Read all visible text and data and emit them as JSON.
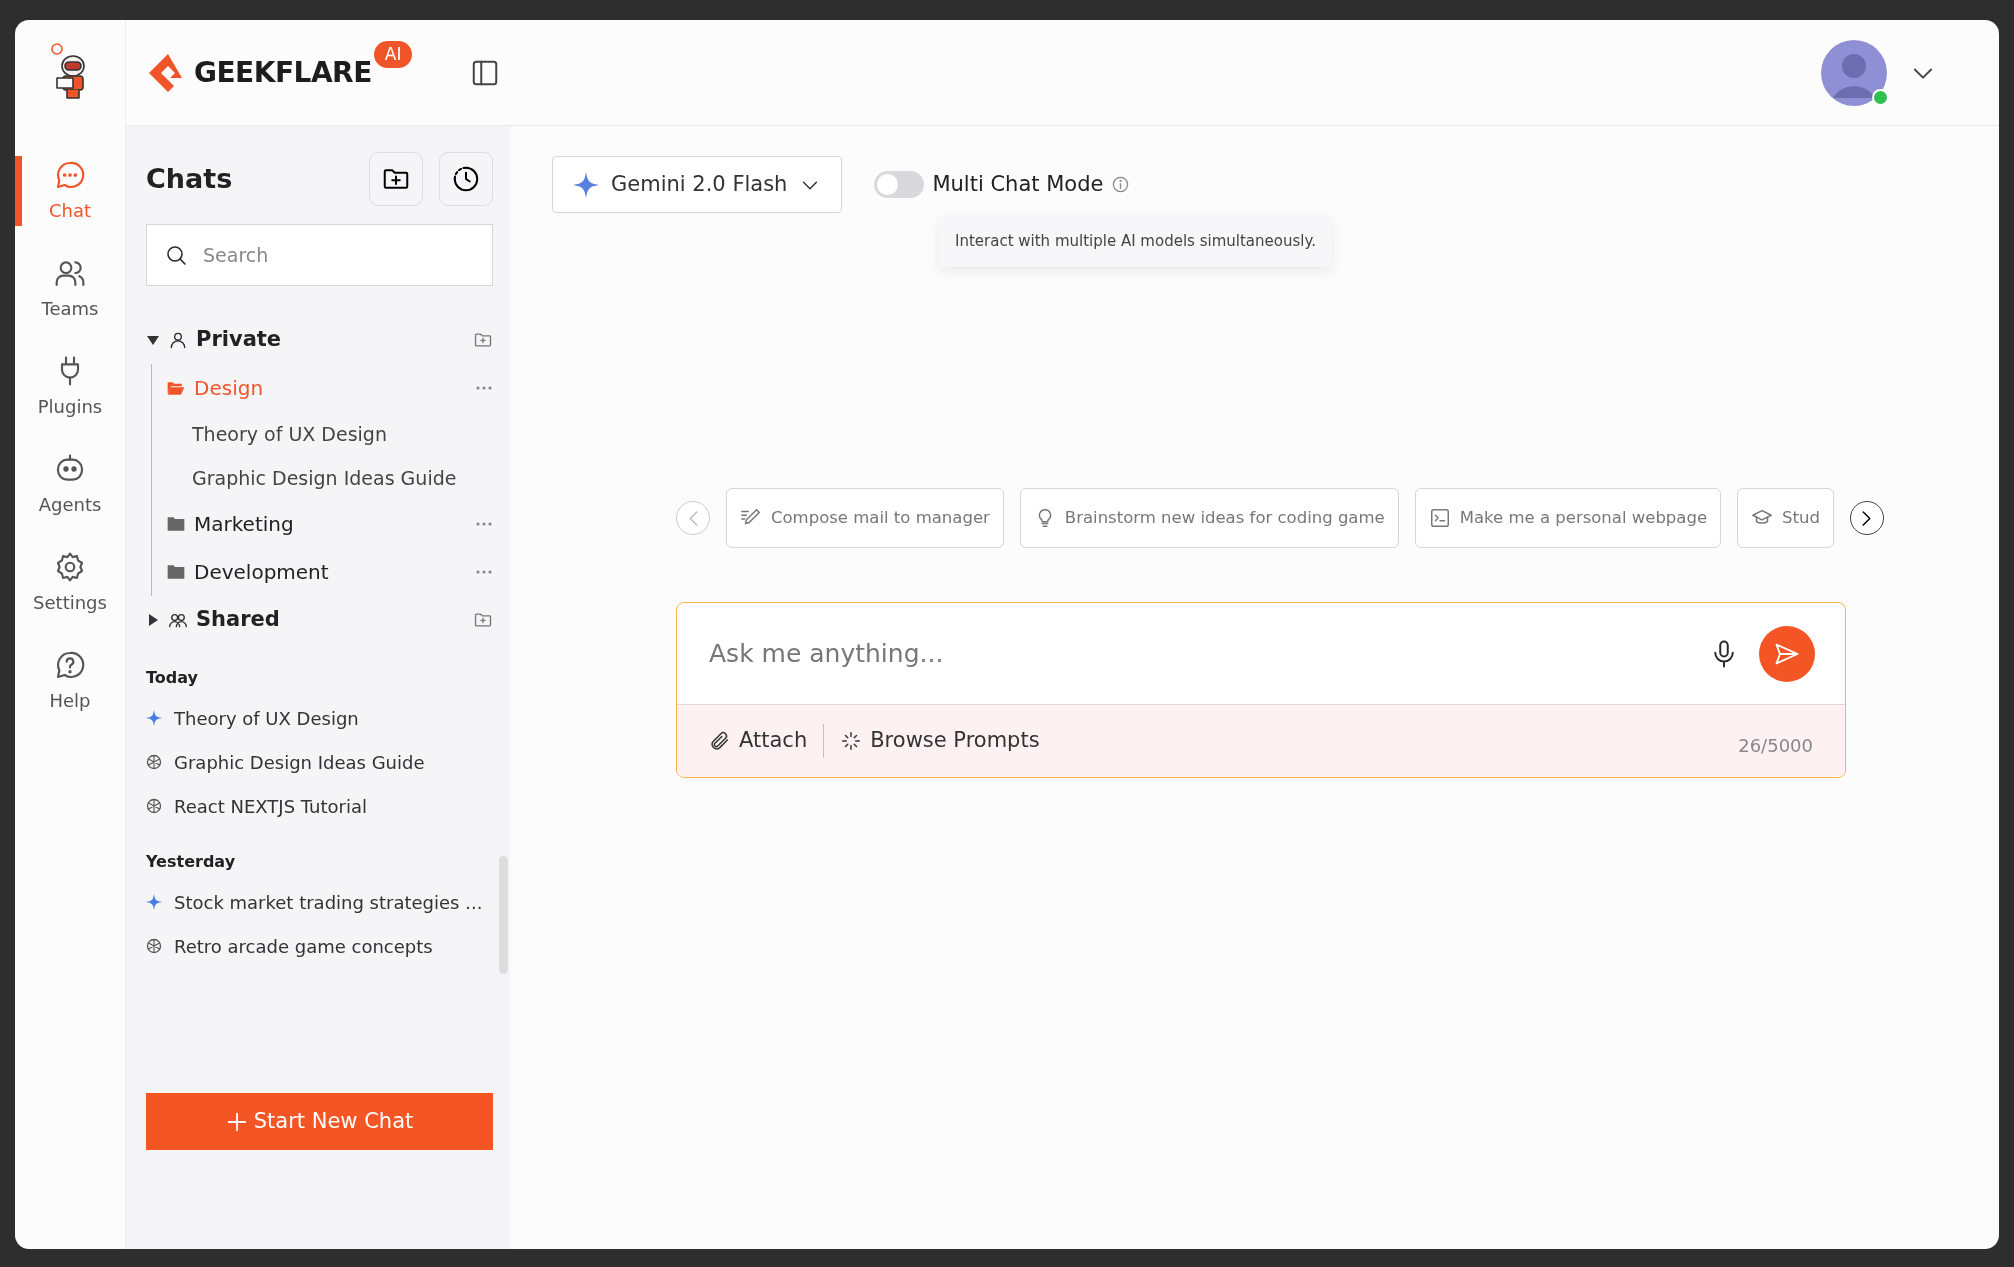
{
  "rail": {
    "items": [
      {
        "label": "Chat",
        "kind": "chat",
        "selected": true
      },
      {
        "label": "Teams",
        "kind": "teams",
        "selected": false
      },
      {
        "label": "Plugins",
        "kind": "plugins",
        "selected": false
      },
      {
        "label": "Agents",
        "kind": "agents",
        "selected": false
      },
      {
        "label": "Settings",
        "kind": "settings",
        "selected": false
      },
      {
        "label": "Help",
        "kind": "help",
        "selected": false
      }
    ]
  },
  "header": {
    "brand": "GEEKFLARE",
    "badge": "AI"
  },
  "sidebar": {
    "title": "Chats",
    "search": {
      "placeholder": "Search"
    },
    "tree": [
      {
        "label": "Private",
        "kind": "person",
        "expanded": true,
        "children": [
          {
            "label": "Design",
            "selected": true,
            "expanded": true,
            "children": [
              {
                "label": "Theory of UX Design"
              },
              {
                "label": "Graphic Design Ideas Guide"
              }
            ]
          },
          {
            "label": "Marketing",
            "selected": false,
            "expanded": false
          },
          {
            "label": "Development",
            "selected": false,
            "expanded": false
          }
        ]
      },
      {
        "label": "Shared",
        "kind": "people",
        "expanded": false
      }
    ],
    "history": [
      {
        "heading": "Today",
        "items": [
          {
            "title": "Theory of UX Design",
            "kind": "sparkle"
          },
          {
            "title": "Graphic Design Ideas Guide",
            "kind": "knot"
          },
          {
            "title": "React NEXTJS Tutorial",
            "kind": "knot"
          }
        ]
      },
      {
        "heading": "Yesterday",
        "items": [
          {
            "title": "Stock market trading strategies ...",
            "kind": "sparkle"
          },
          {
            "title": "Retro arcade game concepts",
            "kind": "knot"
          }
        ]
      }
    ],
    "new_chat_button": "Start New Chat"
  },
  "model_selector": {
    "label": "Gemini 2.0 Flash"
  },
  "multi_chat": {
    "label": "Multi Chat Mode",
    "on": false,
    "tooltip": "Interact with multiple AI models simultaneously."
  },
  "suggestions": [
    {
      "label": "Compose mail to manager",
      "kind": "pen"
    },
    {
      "label": "Brainstorm new ideas for coding game",
      "kind": "bulb"
    },
    {
      "label": "Make me a personal webpage",
      "kind": "terminal"
    },
    {
      "label": "Stud",
      "kind": "cap"
    }
  ],
  "composer": {
    "placeholder": "Ask me anything...",
    "attach": "Attach",
    "browse": "Browse Prompts",
    "counter": "26/5000"
  }
}
